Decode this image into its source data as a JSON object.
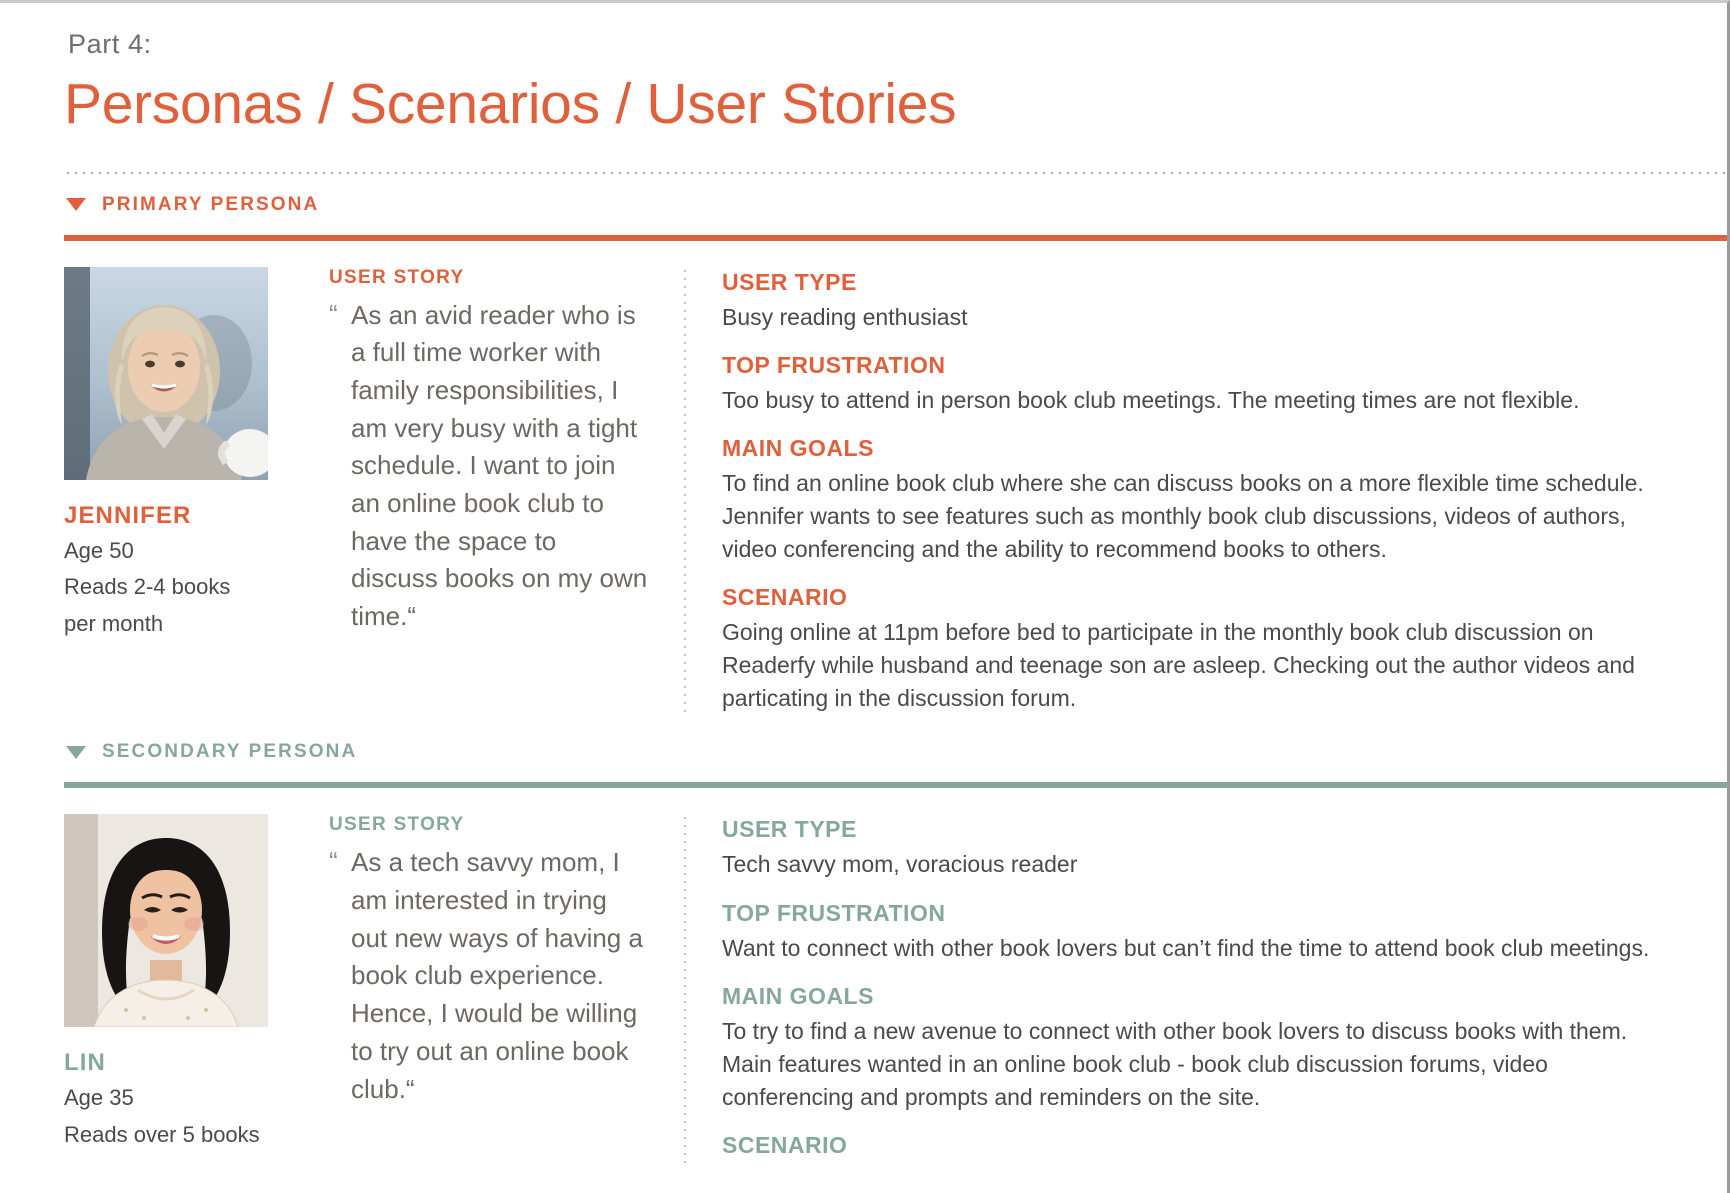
{
  "header": {
    "part_label": "Part 4:",
    "title": "Personas / Scenarios / User Stories"
  },
  "colors": {
    "primary_accent": "#e0603c",
    "secondary_accent": "#85a899",
    "body_text": "#4a4a4a",
    "quote_text": "#6e6863",
    "part_label_text": "#6e6e6e"
  },
  "icons": {
    "collapse_triangle": "triangle-down-icon"
  },
  "sections": [
    {
      "id": "primary",
      "label": "PRIMARY PERSONA",
      "accent": "#e0603c",
      "persona": {
        "photo_alt": "portrait-jennifer",
        "name": "JENNIFER",
        "age": "Age 50",
        "reads_line1": "Reads 2-4 books",
        "reads_line2": "per month"
      },
      "story": {
        "kicker": "USER STORY",
        "quote_open": "“",
        "quote_close": "“",
        "text": "As an avid reader who is a full time worker with family responsibilities, I am very busy with a tight schedule. I want to join an online book club to have the space to discuss books on my own time."
      },
      "details": [
        {
          "head": "USER TYPE",
          "lines": [
            "Busy reading enthusiast"
          ]
        },
        {
          "head": "TOP FRUSTRATION",
          "lines": [
            "Too busy to attend in person book club meetings. The meeting times are not flexible."
          ]
        },
        {
          "head": "MAIN GOALS",
          "lines": [
            "To find an online book club where she can discuss books on a more flexible time schedule.",
            "Jennifer wants to see features such as monthly book club discussions, videos of authors,",
            "video conferencing and the ability to recommend books to others."
          ]
        },
        {
          "head": "SCENARIO",
          "lines": [
            "Going online at 11pm before bed to participate in the monthly book club discussion on",
            "Readerfy while husband and teenage son are asleep. Checking out the author videos and",
            "particating in the discussion forum."
          ]
        }
      ]
    },
    {
      "id": "secondary",
      "label": "SECONDARY PERSONA",
      "accent": "#85a899",
      "persona": {
        "photo_alt": "portrait-lin",
        "name": "LIN",
        "age": "Age 35",
        "reads_line1": "Reads over 5 books",
        "reads_line2": ""
      },
      "story": {
        "kicker": "USER STORY",
        "quote_open": "“",
        "quote_close": "“",
        "text": "As a tech savvy mom, I am interested in trying out new ways of having a book club experience. Hence, I would be willing to try out an online book club."
      },
      "details": [
        {
          "head": "USER TYPE",
          "lines": [
            "Tech savvy mom, voracious reader"
          ]
        },
        {
          "head": "TOP FRUSTRATION",
          "lines": [
            "Want to connect with other book lovers but can’t find the time to attend book club meetings."
          ]
        },
        {
          "head": "MAIN GOALS",
          "lines": [
            "To try to find a new avenue to connect with other book lovers to discuss books with them.",
            "Main features wanted in an online book club - book club discussion forums, video",
            "conferencing and prompts and reminders on the site."
          ]
        },
        {
          "head": "SCENARIO",
          "lines": []
        }
      ]
    }
  ]
}
